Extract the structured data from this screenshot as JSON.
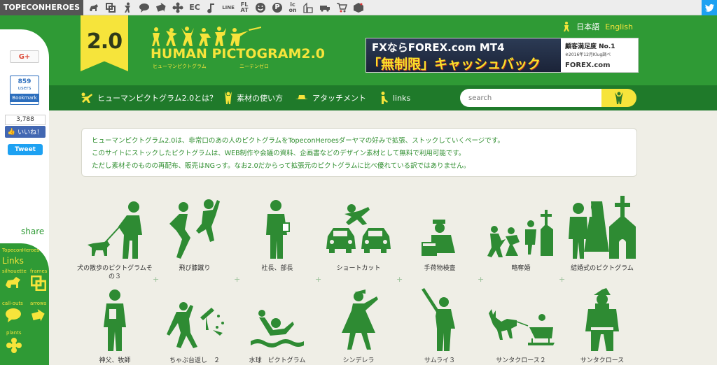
{
  "topbar": {
    "brand": "TOPECONHEROES",
    "icons": [
      {
        "name": "silhouette-icon"
      },
      {
        "name": "frames-icon"
      },
      {
        "name": "human-icon"
      },
      {
        "name": "callout-icon"
      },
      {
        "name": "arrow-icon"
      },
      {
        "name": "plant-icon"
      },
      {
        "name": "ec-icon",
        "text": "EC"
      },
      {
        "name": "note-icon"
      },
      {
        "name": "line-icon",
        "text": "LINE"
      },
      {
        "name": "flat-icon",
        "text": "FL AT"
      },
      {
        "name": "smile-icon"
      },
      {
        "name": "parking-icon",
        "text": "P"
      },
      {
        "name": "icon-text-icon",
        "text": "ic on"
      },
      {
        "name": "building-icon"
      },
      {
        "name": "truck-icon"
      },
      {
        "name": "cart-icon"
      },
      {
        "name": "gift-icon"
      }
    ]
  },
  "header": {
    "logo_number": "2.0",
    "logo_title": "HUMAN PICTOGRAM2.0",
    "logo_sub_jp": "ヒューマンピクトグラム",
    "logo_sub_jp2": "ニーテンゼロ",
    "lang_ja": "日本語",
    "lang_en": "English"
  },
  "ad": {
    "line1": "FXならFOREX.com MT4",
    "line2": "「無制限」キャッシュバック",
    "right1": "顧客満足度 No.1",
    "right2": "※2016年12月Klug調べ",
    "right3": "FOREX.com"
  },
  "nav": {
    "items": [
      {
        "label": "ヒューマンピクトグラム2.0とは？"
      },
      {
        "label": "素材の使い方"
      },
      {
        "label": "アタッチメント"
      },
      {
        "label": "links"
      }
    ],
    "search_placeholder": "search"
  },
  "sidebar": {
    "gplus": "G+",
    "hatena_count": "859",
    "hatena_users": "users",
    "hatena_label": "Bookmark",
    "fb_count": "3,788",
    "fb_like": "いいね！",
    "tweet": "Tweet",
    "share": "share",
    "links_brand": "TopeconHeroes",
    "links_title": "Links",
    "links": {
      "silhouette": "silhouette",
      "frames": "frames",
      "callouts": "call-outs",
      "arrows": "arrows",
      "plants": "plants"
    }
  },
  "intro": {
    "line1": "ヒューマンピクトグラム2.0は、非常口のあの人のピクトグラムをTopeconHeroesダーヤマの好みで拡張、ストックしていくページです。",
    "line2": "このサイトにストックしたピクトグラムは、WEB制作や会議の資料、企画書などのデザイン素材として無料で利用可能です。",
    "line3": "ただし素材そのものの再配布、販売はNGっす。なお2.0だからって拡張元のピクトグラムに比べ優れている訳ではありません。"
  },
  "grid": {
    "row1": [
      {
        "caption": "犬の散歩のピクトグラムその３"
      },
      {
        "caption": "飛び膝蹴り"
      },
      {
        "caption": "社長、部長"
      },
      {
        "caption": "ショートカット"
      },
      {
        "caption": "手荷物検査"
      },
      {
        "caption": "略奪婚"
      },
      {
        "caption": "結婚式のピクトグラム"
      }
    ],
    "row2": [
      {
        "caption": "神父、牧師"
      },
      {
        "caption": "ちゃぶ台返し　２"
      },
      {
        "caption": "水球　ピクトグラム"
      },
      {
        "caption": "シンデレラ"
      },
      {
        "caption": "サムライ３"
      },
      {
        "caption": "サンタクロース２"
      },
      {
        "caption": "サンタクロース"
      }
    ]
  },
  "colors": {
    "green": "#2f9a35",
    "dark_green": "#1f7a2a",
    "yellow": "#f6e43b",
    "pictogram": "#2e8b33"
  }
}
